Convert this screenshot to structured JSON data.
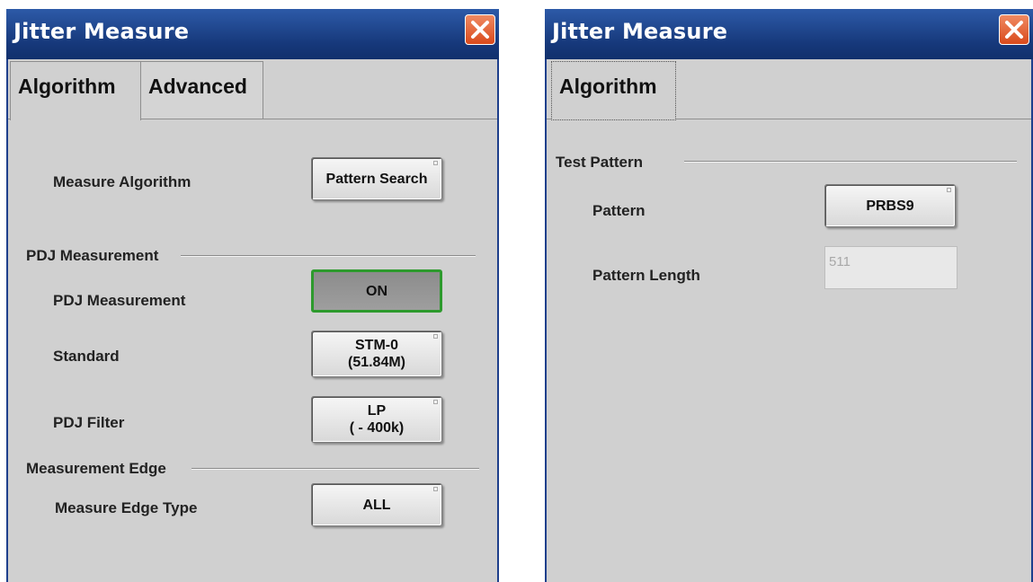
{
  "left_dialog": {
    "title": "Jitter Measure",
    "tabs": [
      {
        "label": "Algorithm",
        "active": true
      },
      {
        "label": "Advanced",
        "active": false
      }
    ],
    "measure_algorithm": {
      "label": "Measure Algorithm",
      "value": "Pattern Search"
    },
    "pdj_section": "PDJ Measurement",
    "pdj_measurement": {
      "label": "PDJ Measurement",
      "value": "ON"
    },
    "standard": {
      "label": "Standard",
      "value_line1": "STM-0",
      "value_line2": "(51.84M)"
    },
    "pdj_filter": {
      "label": "PDJ Filter",
      "value_line1": "LP",
      "value_line2": "( - 400k)"
    },
    "edge_section": "Measurement Edge",
    "measure_edge_type": {
      "label": "Measure Edge Type",
      "value": "ALL"
    }
  },
  "right_dialog": {
    "title": "Jitter Measure",
    "tabs": [
      {
        "label": "Algorithm",
        "active": true
      }
    ],
    "test_pattern_section": "Test Pattern",
    "pattern": {
      "label": "Pattern",
      "value": "PRBS9"
    },
    "pattern_length": {
      "label": "Pattern Length",
      "value": "511"
    }
  },
  "colors": {
    "title_bar": "#16387a",
    "panel": "#d0d0d0",
    "close": "#d94a1c",
    "on_border": "#2d9a2d"
  },
  "icons": {
    "close": "close-icon"
  }
}
